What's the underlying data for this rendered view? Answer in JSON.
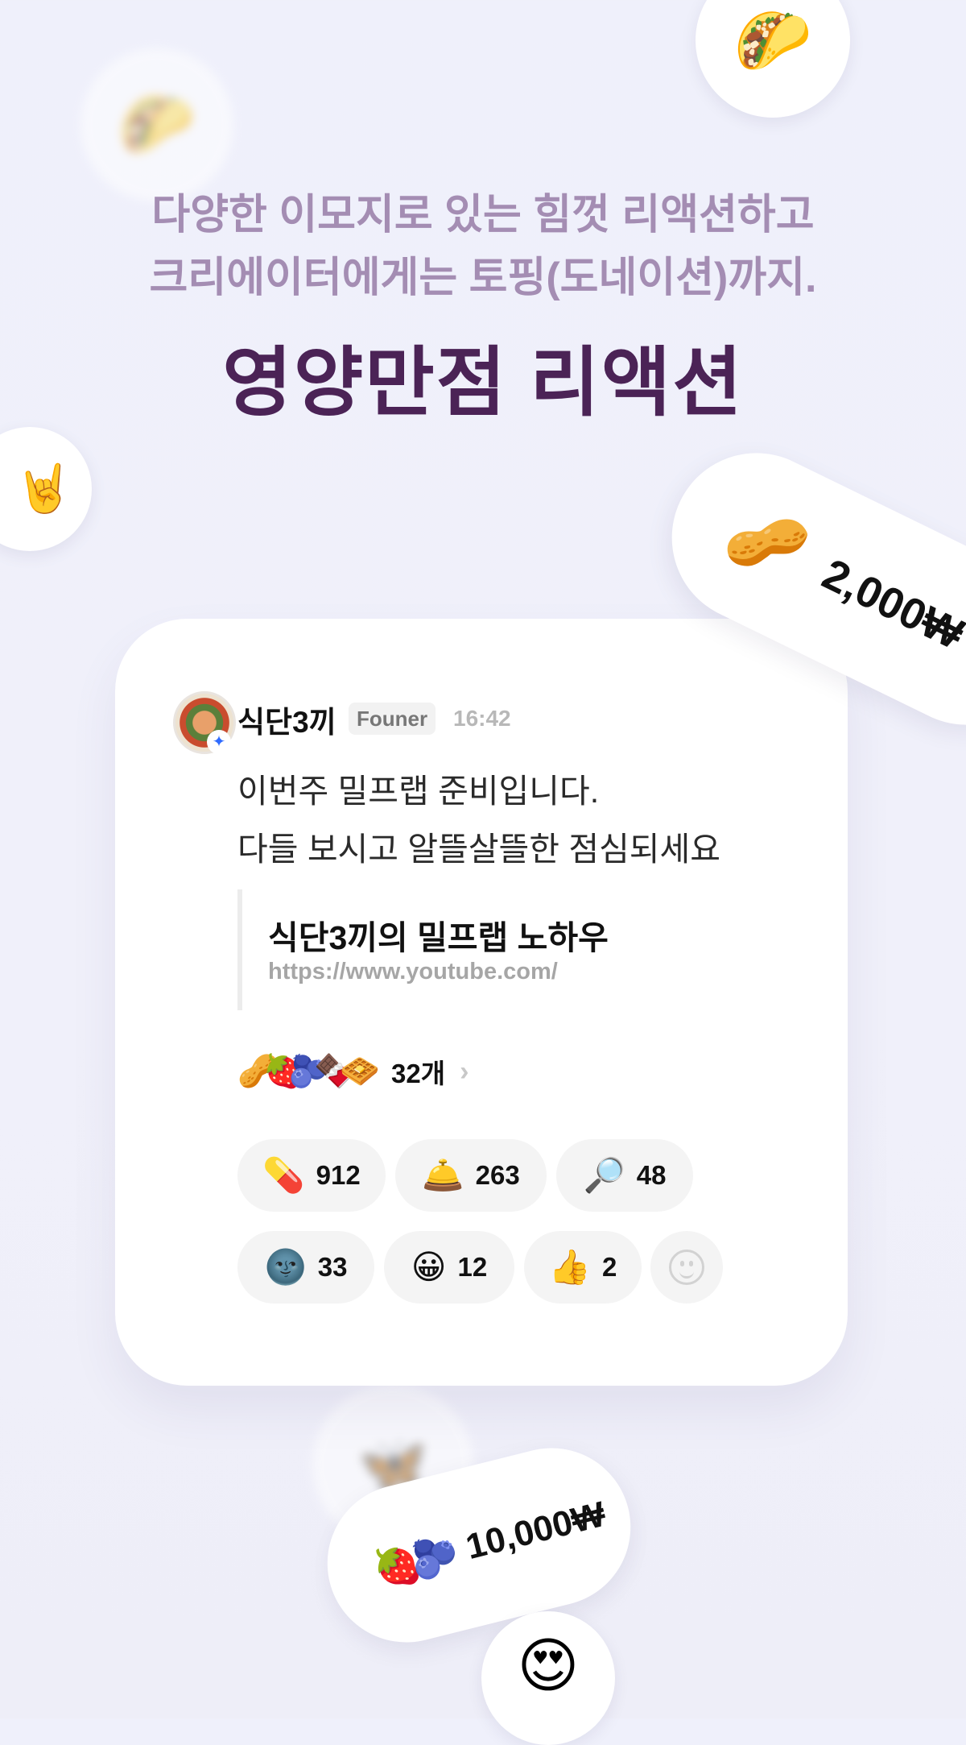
{
  "decor": {
    "bubble_top_right": "🌮",
    "bubble_top_left_blurred": "🌮",
    "bubble_left": "🤘",
    "bubble_center_blurred": "🦋",
    "bubble_bottom": "😍"
  },
  "hero": {
    "subtitle_line1": "다양한 이모지로 있는 힘껏 리액션하고",
    "subtitle_line2": "크리에이터에게는 토핑(도네이션)까지.",
    "headline": "영양만점 리액션"
  },
  "donation_pills": [
    {
      "emoji": "🥜",
      "amount": "2,000₩"
    },
    {
      "emoji": "🍓🫐",
      "amount": "10,000₩"
    }
  ],
  "post": {
    "author": "식단3끼",
    "role_badge": "Founer",
    "time": "16:42",
    "message_line1": "이번주 밀프랩 준비입니다.",
    "message_line2": "다들 보시고 알뜰살뜰한 점심되세요",
    "link_title": "식단3끼의 밀프랩 노하우",
    "link_url": "https://www.youtube.com/",
    "donations_emoji": "🥜🍓🫐🍫🧇",
    "donations_count": "32개",
    "reactions": [
      {
        "emoji": "💊",
        "count": "912"
      },
      {
        "emoji": "🛎️",
        "count": "263"
      },
      {
        "emoji": "🔎",
        "count": "48"
      },
      {
        "emoji": "🌚",
        "count": "33"
      },
      {
        "emoji": "😀",
        "count": "12"
      },
      {
        "emoji": "👍",
        "count": "2"
      }
    ]
  }
}
